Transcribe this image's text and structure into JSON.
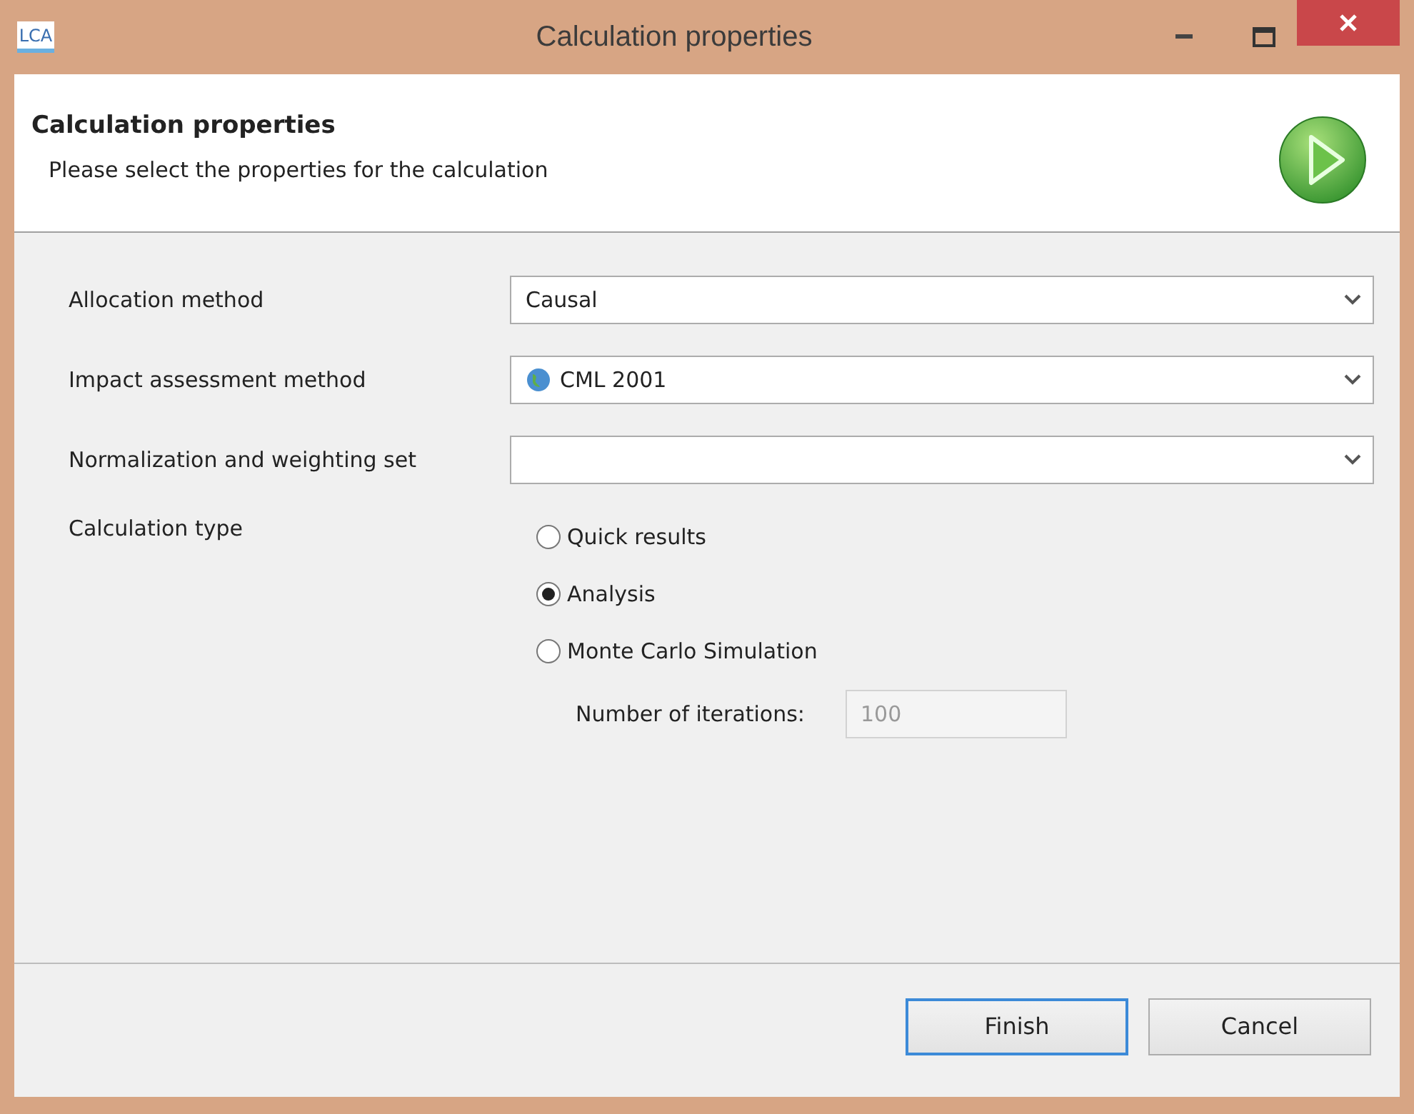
{
  "window": {
    "title": "Calculation properties",
    "logo": "LCA"
  },
  "header": {
    "title": "Calculation properties",
    "subtitle": "Please select the properties for the calculation"
  },
  "fields": [
    {
      "label": "Allocation method",
      "value": "Causal",
      "kind": "plain"
    },
    {
      "label": "Impact assessment method",
      "value": "CML 2001",
      "kind": "with_icon"
    },
    {
      "label": "Normalization and weighting set",
      "kind": "plain"
    }
  ],
  "calculation_type": {
    "label": "Calculation type",
    "options": [
      {
        "label": "Quick results",
        "selected": false
      },
      {
        "label": "Analysis",
        "selected": true
      },
      {
        "label": "Monte Carlo Simulation",
        "selected": false
      }
    ],
    "iterations": {
      "label": "Number of iterations:",
      "value": "100",
      "disabled": true
    }
  },
  "buttons": [
    {
      "label": "Finish",
      "default": true
    },
    {
      "label": "Cancel",
      "default": false
    }
  ]
}
